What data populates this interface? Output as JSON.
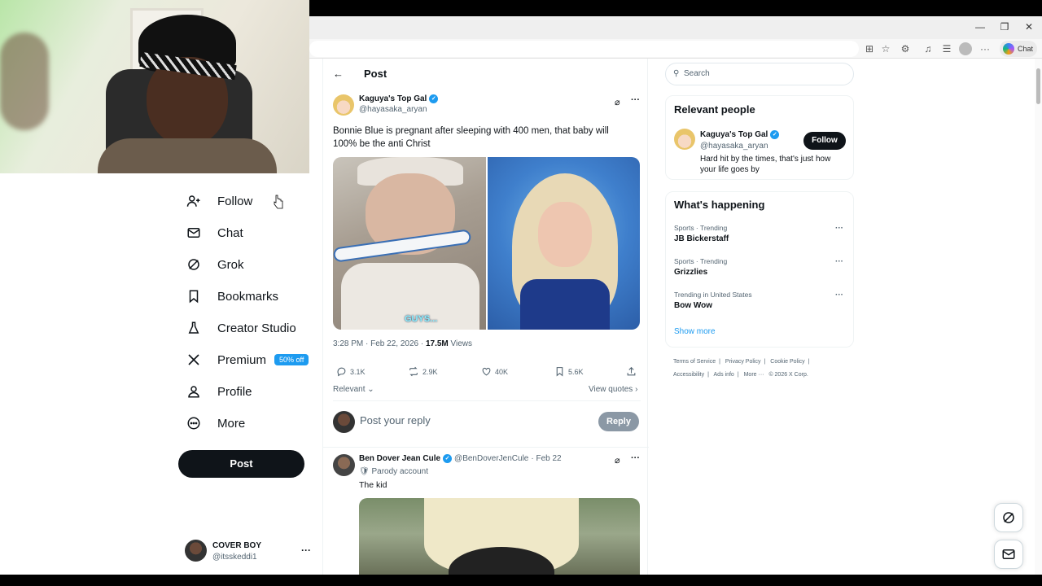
{
  "browser": {
    "toolbar_icons": [
      "apps-icon",
      "favorite-star-icon",
      "extensions-icon",
      "read-aloud-icon",
      "favorites-icon",
      "profile-icon",
      "settings-more-icon"
    ],
    "chat_label": "Chat"
  },
  "nav": {
    "items": [
      {
        "label": "Follow",
        "icon": "add-person-icon"
      },
      {
        "label": "Chat",
        "icon": "mail-icon"
      },
      {
        "label": "Grok",
        "icon": "grok-icon"
      },
      {
        "label": "Bookmarks",
        "icon": "bookmark-icon"
      },
      {
        "label": "Creator Studio",
        "icon": "flask-icon"
      },
      {
        "label": "Premium",
        "icon": "x-logo-icon",
        "badge": "50% off"
      },
      {
        "label": "Profile",
        "icon": "person-icon"
      },
      {
        "label": "More",
        "icon": "more-circle-icon"
      }
    ],
    "post_button": "Post",
    "account": {
      "name": "COVER BOY",
      "handle": "@itsskeddi1"
    }
  },
  "post": {
    "header": "Post",
    "author": {
      "name": "Kaguya's Top Gal",
      "handle": "@hayasaka_aryan"
    },
    "text": "Bonnie Blue is pregnant after sleeping with 400 men, that baby will 100% be the anti Christ",
    "media_caption": "GUYS...",
    "time": "3:28 PM · Feb 22, 2026 · ",
    "views_count": "17.5M",
    "views_label": " Views",
    "stats": {
      "replies": "3.1K",
      "reposts": "2.9K",
      "likes": "40K",
      "bookmarks": "5.6K"
    },
    "sort_label": "Relevant",
    "view_quotes": "View quotes",
    "reply_placeholder": "Post your reply",
    "reply_button": "Reply"
  },
  "reply": {
    "name": "Ben Dover Jean Cule",
    "handle": "@BenDoverJenCule",
    "date": "· Feb 22",
    "parody": "Parody account",
    "text": "The kid"
  },
  "sidebar": {
    "search_placeholder": "Search",
    "relevant_title": "Relevant people",
    "person": {
      "name": "Kaguya's Top Gal",
      "handle": "@hayasaka_aryan",
      "bio": "Hard hit by the times, that's just how your life goes by",
      "follow": "Follow"
    },
    "happening_title": "What's happening",
    "trends": [
      {
        "category": "Sports · Trending",
        "title": "JB Bickerstaff"
      },
      {
        "category": "Sports · Trending",
        "title": "Grizzlies"
      },
      {
        "category": "Trending in United States",
        "title": "Bow Wow"
      }
    ],
    "show_more": "Show more",
    "footer": [
      "Terms of Service",
      "|",
      "Privacy Policy",
      "|",
      "Cookie Policy",
      "|",
      "Accessibility",
      "|",
      "Ads info",
      "|",
      "More ···",
      "© 2026 X Corp."
    ]
  },
  "colors": {
    "accent": "#1d9bf0",
    "text": "#0f1419",
    "muted": "#536471"
  }
}
